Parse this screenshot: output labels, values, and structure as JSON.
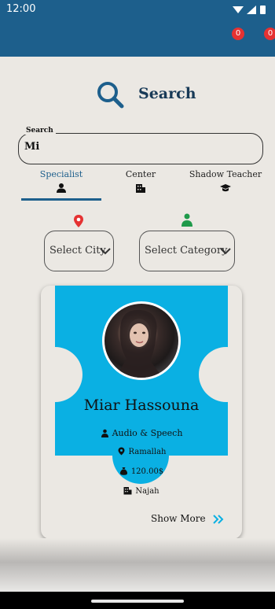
{
  "status_bar": {
    "time": "12:00"
  },
  "app_bar": {
    "badge_left": "0",
    "badge_right": "0"
  },
  "search_header": {
    "title": "Search",
    "icon": "search-icon"
  },
  "search_field": {
    "label": "Search",
    "value": "Mi"
  },
  "tabs": [
    {
      "label": "Specialist",
      "icon": "person-icon",
      "active": true
    },
    {
      "label": "Center",
      "icon": "building-icon",
      "active": false
    },
    {
      "label": "Shadow Teacher",
      "icon": "graduation-cap-icon",
      "active": false
    }
  ],
  "filters": {
    "city": {
      "label": "Select City",
      "icon": "location-pin-icon"
    },
    "category": {
      "label": "Select Category",
      "icon": "user-category-icon"
    }
  },
  "result_card": {
    "name": "Miar Hassouna",
    "specialty": "Audio & Speech",
    "city": "Ramallah",
    "price": "120.00$",
    "center": "Najah",
    "show_more": "Show More"
  },
  "colors": {
    "primary": "#1d5f8c",
    "card_accent": "#0ab0e3",
    "badge": "#e53232",
    "pin_red": "#e53232",
    "category_green": "#1f9a4a",
    "background": "#ebe8e3"
  }
}
